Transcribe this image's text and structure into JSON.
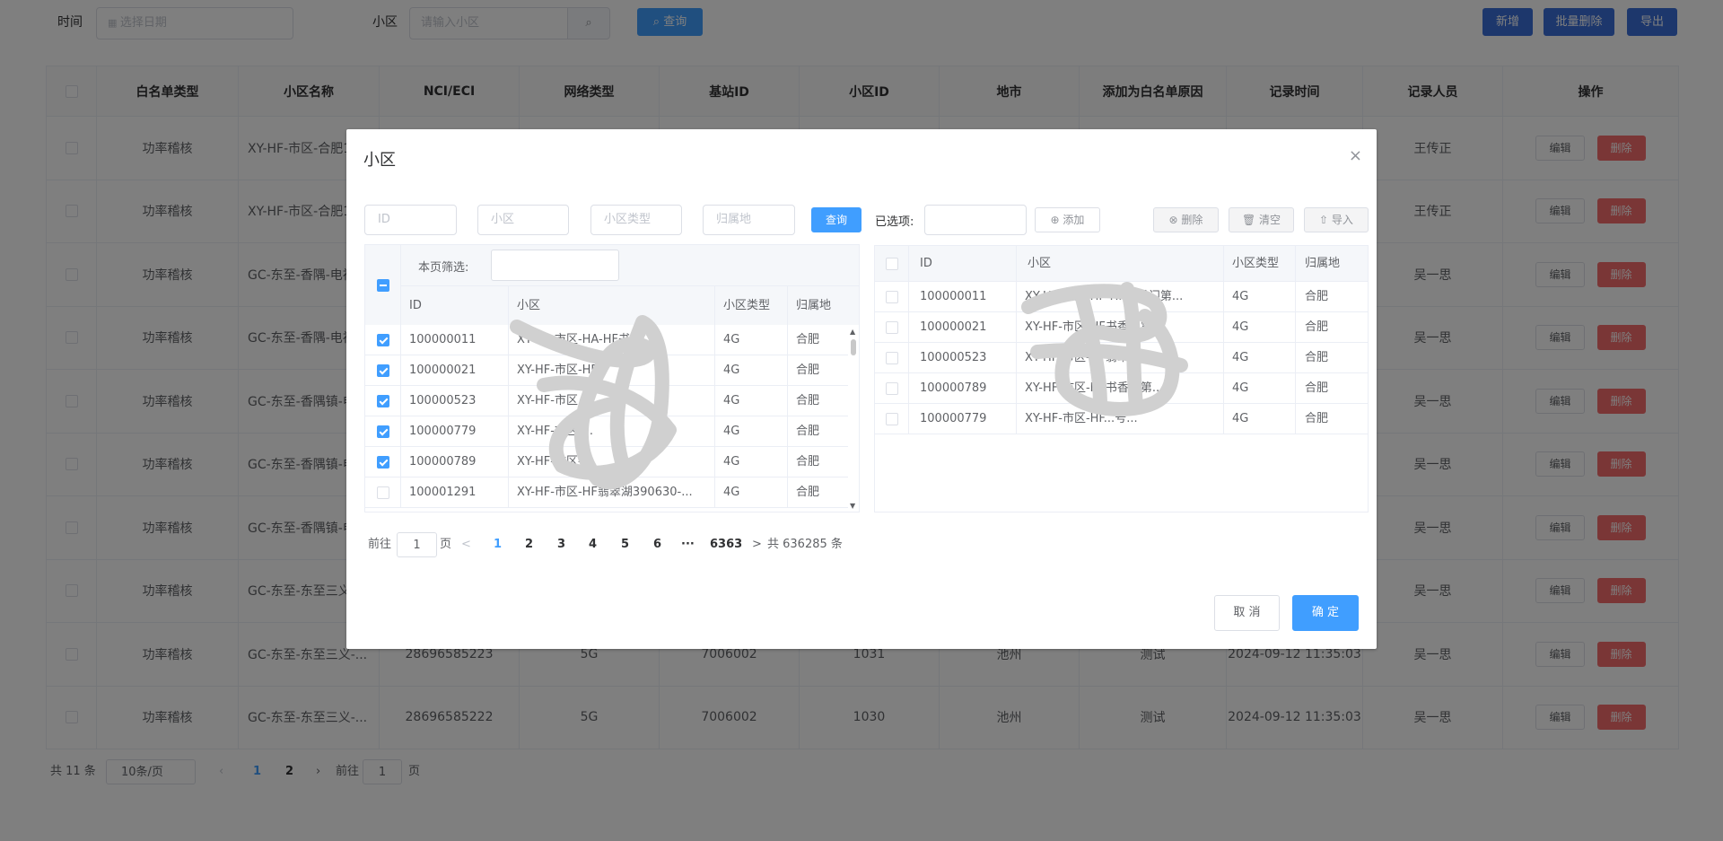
{
  "filter": {
    "time_label": "时间",
    "date_placeholder": "选择日期",
    "cell_label": "小区",
    "cell_placeholder": "请输入小区",
    "query_label": "查询",
    "add_label": "新增",
    "batch_delete_label": "批量删除",
    "export_label": "导出"
  },
  "table": {
    "headers": [
      "白名单类型",
      "小区名称",
      "NCI/ECI",
      "网络类型",
      "基站ID",
      "小区ID",
      "地市",
      "添加为白名单原因",
      "记录时间",
      "记录人员",
      "操作"
    ],
    "edit_label": "编辑",
    "delete_label": "删除",
    "rows": [
      {
        "type": "功率稽核",
        "name": "XY-HF-市区-合肥1",
        "nci": "",
        "net": "",
        "enb": "",
        "cid": "",
        "city": "",
        "reason": "",
        "time": "",
        "person": "王传正"
      },
      {
        "type": "功率稽核",
        "name": "XY-HF-市区-合肥1",
        "nci": "",
        "net": "",
        "enb": "",
        "cid": "",
        "city": "",
        "reason": "",
        "time": "",
        "person": "王传正"
      },
      {
        "type": "功率稽核",
        "name": "GC-东至-香隅-电视",
        "nci": "",
        "net": "",
        "enb": "",
        "cid": "",
        "city": "",
        "reason": "",
        "time": "",
        "person": "吴一思"
      },
      {
        "type": "功率稽核",
        "name": "GC-东至-香隅-电视",
        "nci": "",
        "net": "",
        "enb": "",
        "cid": "",
        "city": "",
        "reason": "",
        "time": "",
        "person": "吴一思"
      },
      {
        "type": "功率稽核",
        "name": "GC-东至-香隅镇-电视",
        "nci": "",
        "net": "",
        "enb": "",
        "cid": "",
        "city": "",
        "reason": "",
        "time": "",
        "person": "吴一思"
      },
      {
        "type": "功率稽核",
        "name": "GC-东至-香隅镇-电视",
        "nci": "",
        "net": "",
        "enb": "",
        "cid": "",
        "city": "",
        "reason": "",
        "time": "",
        "person": "吴一思"
      },
      {
        "type": "功率稽核",
        "name": "GC-东至-香隅镇-电视",
        "nci": "",
        "net": "",
        "enb": "",
        "cid": "",
        "city": "",
        "reason": "",
        "time": "",
        "person": "吴一思"
      },
      {
        "type": "功率稽核",
        "name": "GC-东至-东至三义",
        "nci": "",
        "net": "",
        "enb": "",
        "cid": "",
        "city": "",
        "reason": "",
        "time": "",
        "person": "吴一思"
      },
      {
        "type": "功率稽核",
        "name": "GC-东至-东至三义-...",
        "nci": "28696585223",
        "net": "5G",
        "enb": "7006002",
        "cid": "1031",
        "city": "池州",
        "reason": "测试",
        "time": "2024-09-12 11:35:03",
        "person": "吴一思"
      },
      {
        "type": "功率稽核",
        "name": "GC-东至-东至三义-...",
        "nci": "28696585222",
        "net": "5G",
        "enb": "7006002",
        "cid": "1030",
        "city": "池州",
        "reason": "测试",
        "time": "2024-09-12 11:35:03",
        "person": "吴一思"
      }
    ]
  },
  "pager": {
    "total": "共 11 条",
    "page_size": "10条/页",
    "pages": [
      "1",
      "2"
    ],
    "goto_prefix": "前往",
    "goto_value": "1",
    "goto_suffix": "页"
  },
  "dialog": {
    "title": "小区",
    "close": "×",
    "search": {
      "id_placeholder": "ID",
      "cell_placeholder": "小区",
      "type_placeholder": "小区类型",
      "region_placeholder": "归属地",
      "query_label": "查询"
    },
    "selected_label": "已选项:",
    "add_label": "添加",
    "remove_label": "删除",
    "clear_label": "清空",
    "import_label": "导入",
    "page_filter_label": "本页筛选:",
    "columns": [
      "ID",
      "小区",
      "小区类型",
      "归属地"
    ],
    "left_rows": [
      {
        "checked": true,
        "id": "100000011",
        "cell": "XY-HF-市区-HA-HF书香门...",
        "type": "4G",
        "region": "合肥"
      },
      {
        "checked": true,
        "id": "100000021",
        "cell": "XY-HF-市区-HF...",
        "type": "4G",
        "region": "合肥"
      },
      {
        "checked": true,
        "id": "100000523",
        "cell": "XY-HF-市区...",
        "type": "4G",
        "region": "合肥"
      },
      {
        "checked": true,
        "id": "100000779",
        "cell": "XY-HF-市区-...",
        "type": "4G",
        "region": "合肥"
      },
      {
        "checked": true,
        "id": "100000789",
        "cell": "XY-HF-市区-...",
        "type": "4G",
        "region": "合肥"
      },
      {
        "checked": false,
        "id": "100001291",
        "cell": "XY-HF-市区-HF翡翠湖390630-...",
        "type": "4G",
        "region": "合肥"
      }
    ],
    "right_rows": [
      {
        "id": "100000011",
        "cell": "XY-HF-市区-HF-HF书香门第...",
        "type": "4G",
        "region": "合肥"
      },
      {
        "id": "100000021",
        "cell": "XY-HF-市区-HF书香门第...",
        "type": "4G",
        "region": "合肥"
      },
      {
        "id": "100000523",
        "cell": "XY-HF-市区-HF翡翠湖...",
        "type": "4G",
        "region": "合肥"
      },
      {
        "id": "100000789",
        "cell": "XY-HF-市区-HF书香门第...",
        "type": "4G",
        "region": "合肥"
      },
      {
        "id": "100000779",
        "cell": "XY-HF-市区-HF...号...",
        "type": "4G",
        "region": "合肥"
      }
    ],
    "pager": {
      "goto_prefix": "前往",
      "goto_value": "1",
      "goto_suffix": "页",
      "prev": "<",
      "pages": [
        "1",
        "2",
        "3",
        "4",
        "5",
        "6"
      ],
      "ellipsis": "···",
      "last_page": "6363",
      "next": ">",
      "total": "共 636285 条"
    },
    "cancel_label": "取 消",
    "confirm_label": "确 定"
  },
  "colors": {
    "primary": "#409eff",
    "danger": "#f56c6c",
    "overlay": "rgba(0,0,0,0.5)"
  }
}
